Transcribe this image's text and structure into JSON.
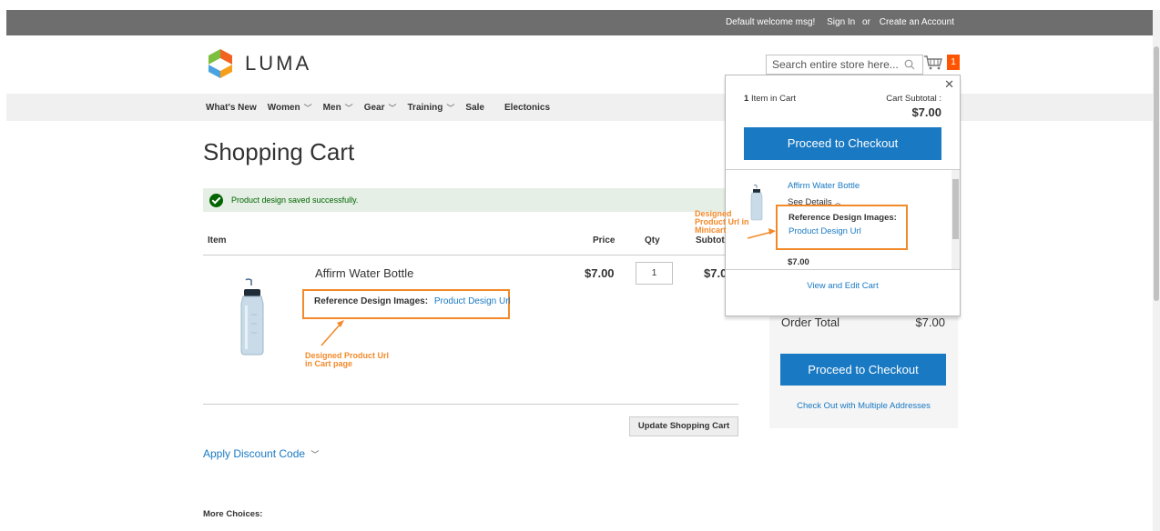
{
  "topbar": {
    "welcome": "Default welcome msg!",
    "sign_in": "Sign In",
    "or": "or",
    "create_account": "Create an Account"
  },
  "header": {
    "logo_text": "LUMA",
    "search_placeholder": "Search entire store here...",
    "cart_count": "1"
  },
  "nav": {
    "items": [
      {
        "label": "What's New",
        "has_dropdown": false
      },
      {
        "label": "Women",
        "has_dropdown": true
      },
      {
        "label": "Men",
        "has_dropdown": true
      },
      {
        "label": "Gear",
        "has_dropdown": true
      },
      {
        "label": "Training",
        "has_dropdown": true
      },
      {
        "label": "Sale",
        "has_dropdown": false
      },
      {
        "label": "Electonics",
        "has_dropdown": false
      }
    ]
  },
  "page": {
    "title": "Shopping Cart",
    "message": "Product design saved successfully."
  },
  "cart_table": {
    "headers": {
      "item": "Item",
      "price": "Price",
      "qty": "Qty",
      "subtotal": "Subtotal"
    },
    "row": {
      "name": "Affirm Water Bottle",
      "reference_label": "Reference Design Images:",
      "reference_link": "Product Design Url",
      "price": "$7.00",
      "qty": "1",
      "subtotal": "$7.0"
    },
    "update_button": "Update Shopping Cart"
  },
  "annotations": {
    "cart_page_line1": "Designed Product Url",
    "cart_page_line2": "in Cart page",
    "minicart_line1": "Designed",
    "minicart_line2": "Product Url in",
    "minicart_line3": "Minicart"
  },
  "discount": {
    "label": "Apply Discount Code"
  },
  "more_choices": "More Choices:",
  "summary": {
    "order_total_label": "Order Total",
    "order_total_value": "$7.00",
    "checkout_button": "Proceed to Checkout",
    "multi_address": "Check Out with Multiple Addresses"
  },
  "minicart": {
    "count": "1",
    "items_suffix": "Item in Cart",
    "subtotal_label": "Cart Subtotal :",
    "subtotal_value": "$7.00",
    "checkout_button": "Proceed to Checkout",
    "item": {
      "name": "Affirm Water Bottle",
      "see_details": "See Details",
      "reference_label": "Reference Design Images:",
      "reference_link": "Product Design Url",
      "price": "$7.00"
    },
    "view_edit": "View and Edit Cart"
  },
  "colors": {
    "accent": "#1979c3",
    "annotation": "#f38a2a",
    "cart_counter": "#ff5501",
    "success_bg": "#e5efe5"
  }
}
